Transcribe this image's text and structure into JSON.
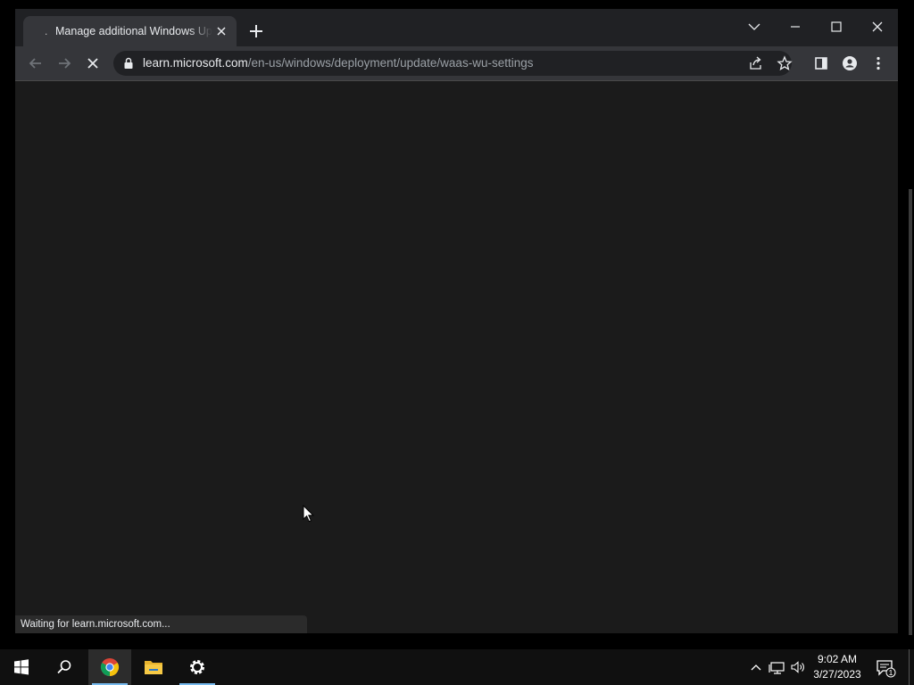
{
  "browser": {
    "tab": {
      "title": "Manage additional Windows Update settings - Windows Deployment",
      "favicon": "loading-dot"
    },
    "url": {
      "host": "learn.microsoft.com",
      "path": "/en-us/windows/deployment/update/waas-wu-settings"
    },
    "status_text": "Waiting for learn.microsoft.com...",
    "icons": {
      "back": "back-arrow-icon",
      "forward": "forward-arrow-icon",
      "stop": "stop-loading-icon",
      "lock": "lock-icon",
      "share": "share-icon",
      "bookmark": "star-icon",
      "side_panel": "side-panel-icon",
      "profile": "profile-icon",
      "menu": "kebab-menu-icon",
      "tab_search": "chevron-down-icon",
      "minimize": "minimize-icon",
      "maximize": "maximize-icon",
      "close": "close-icon",
      "new_tab": "plus-icon"
    },
    "colors": {
      "titlebar": "#202124",
      "toolbar": "#35363a",
      "content": "#1b1b1b"
    }
  },
  "taskbar": {
    "apps": [
      "start-icon",
      "search-icon",
      "chrome-icon",
      "file-explorer-icon",
      "settings-icon"
    ],
    "clock": {
      "time": "9:02 AM",
      "date": "3/27/2023"
    },
    "notification_count": "1",
    "tray_icons": [
      "chevron-up-icon",
      "network-icon",
      "volume-icon"
    ],
    "accent": "#76b9ed"
  }
}
